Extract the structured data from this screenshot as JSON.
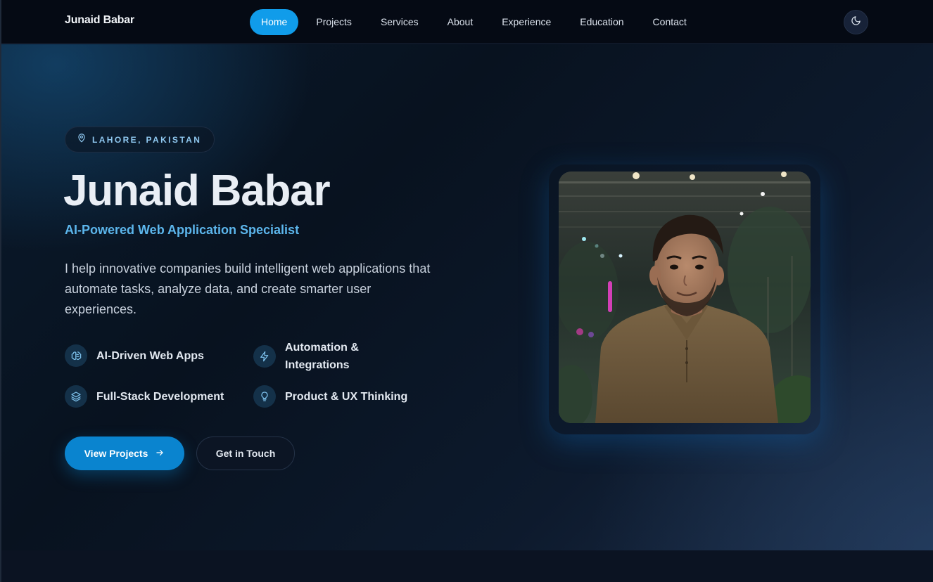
{
  "nav": {
    "brand": "Junaid Babar",
    "links": [
      {
        "label": "Home",
        "active": true
      },
      {
        "label": "Projects",
        "active": false
      },
      {
        "label": "Services",
        "active": false
      },
      {
        "label": "About",
        "active": false
      },
      {
        "label": "Experience",
        "active": false
      },
      {
        "label": "Education",
        "active": false
      },
      {
        "label": "Contact",
        "active": false
      }
    ],
    "theme_icon": "moon-icon"
  },
  "hero": {
    "location": "LAHORE, PAKISTAN",
    "location_icon": "map-pin-icon",
    "name": "Junaid Babar",
    "tagline": "AI-Powered Web Application Specialist",
    "description": "I help innovative companies build intelligent web applications that automate tasks, analyze data, and create smarter user experiences.",
    "features": [
      {
        "label": "AI-Driven Web Apps",
        "icon": "brain-icon"
      },
      {
        "label": "Automation & Integrations",
        "icon": "lightning-icon"
      },
      {
        "label": "Full-Stack Development",
        "icon": "layers-icon"
      },
      {
        "label": "Product & UX Thinking",
        "icon": "lightbulb-icon"
      }
    ],
    "primary_button": "View Projects",
    "primary_button_icon": "arrow-right-icon",
    "secondary_button": "Get in Touch"
  },
  "colors": {
    "accent": "#109cea",
    "primary_button": "#0a84cf",
    "tagline": "#5cb6ec",
    "background": "#08121f"
  }
}
